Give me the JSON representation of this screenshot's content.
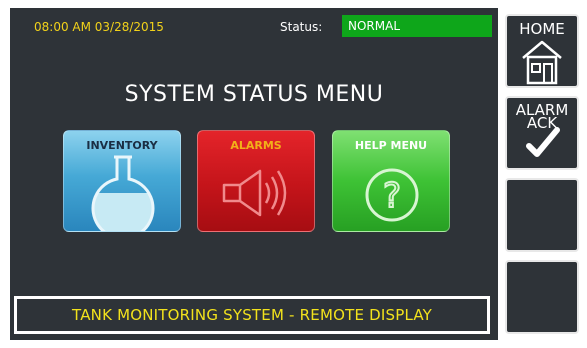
{
  "header": {
    "datetime": "08:00 AM 03/28/2015",
    "status_label": "Status:",
    "status_value": "NORMAL"
  },
  "menu": {
    "title": "SYSTEM STATUS MENU",
    "tiles": [
      {
        "label": "INVENTORY",
        "icon": "flask-icon"
      },
      {
        "label": "ALARMS",
        "icon": "speaker-icon"
      },
      {
        "label": "HELP MENU",
        "icon": "question-icon"
      }
    ]
  },
  "footer": {
    "banner": "TANK MONITORING SYSTEM -  REMOTE DISPLAY"
  },
  "side_buttons": {
    "home": {
      "label": "HOME",
      "icon": "house-icon"
    },
    "alarm_ack": {
      "label_line1": "ALARM",
      "label_line2": "ACK",
      "icon": "checkmark-icon"
    }
  },
  "colors": {
    "panel_bg": "#2e3338",
    "status_normal": "#0ea61a",
    "datetime_text": "#f2d21a",
    "banner_text": "#f2e21c"
  }
}
